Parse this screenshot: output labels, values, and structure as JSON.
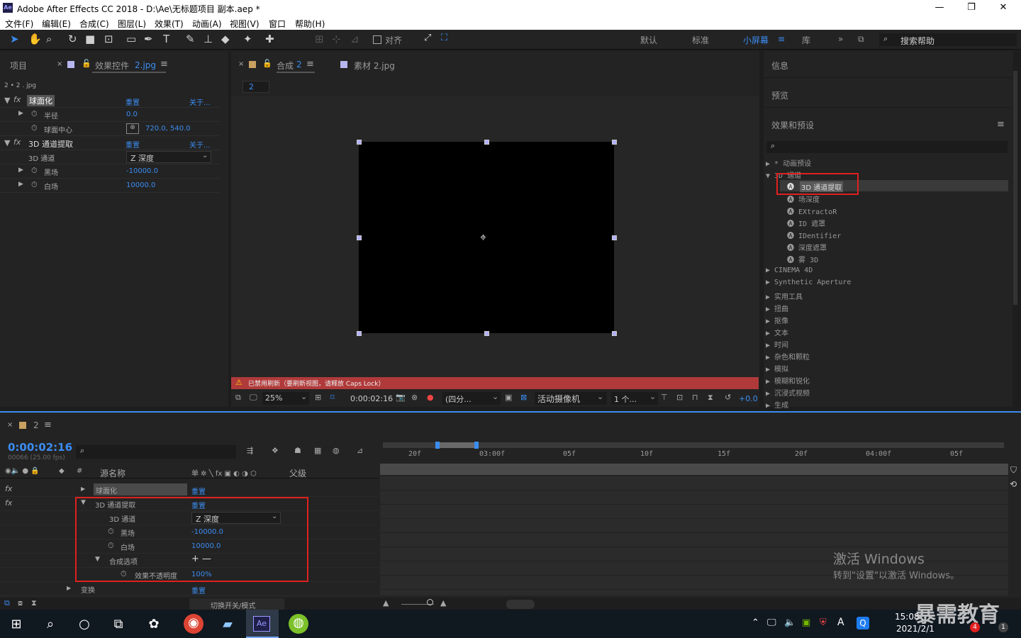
{
  "window": {
    "title": "Adobe After Effects CC 2018 - D:\\Ae\\无标题项目 副本.aep *",
    "logo": "Ae"
  },
  "menu": [
    "文件(F)",
    "编辑(E)",
    "合成(C)",
    "图层(L)",
    "效果(T)",
    "动画(A)",
    "视图(V)",
    "窗口",
    "帮助(H)"
  ],
  "toolbar": {
    "align_label": "对齐",
    "workspaces": [
      "默认",
      "标准",
      "小屏幕",
      "库"
    ],
    "search_placeholder": "搜索帮助"
  },
  "left_panel": {
    "tab_project": "项目",
    "tab_effects": "效果控件",
    "tab_effects_target": "2.jpg",
    "breadcrumb": "2 • 2 . jpg",
    "effects": [
      {
        "name": "球面化",
        "reset": "重置",
        "about": "关于...",
        "props": [
          {
            "name": "半径",
            "value": "0.0"
          },
          {
            "name": "球面中心",
            "value": "720.0, 540.0"
          }
        ]
      },
      {
        "name": "3D 通道提取",
        "reset": "重置",
        "about": "关于...",
        "props": [
          {
            "name": "3D 通道",
            "value": "Z 深度"
          },
          {
            "name": "黑场",
            "value": "-10000.0"
          },
          {
            "name": "白场",
            "value": "10000.0"
          }
        ]
      }
    ]
  },
  "center_panel": {
    "tab_comp": "合成",
    "tab_comp_target": "2",
    "tab_footage": "素材 2.jpg",
    "sub_tab": "2",
    "warning": "已禁用刷新（要刷新视图，请释放 Caps Lock）",
    "zoom": "25%",
    "timecode": "0:00:02:16",
    "resolution": "(四分...",
    "camera": "活动摄像机",
    "views": "1 个...",
    "exposure": "+0.0"
  },
  "right_panel": {
    "info": "信息",
    "preview": "预览",
    "effects_presets": "效果和预设",
    "items": [
      {
        "label": "▶ * 动画预设"
      },
      {
        "label": "▼ 3D 通道"
      },
      {
        "label": "3D 通道提取"
      },
      {
        "label": "场深度"
      },
      {
        "label": "EXtractoR"
      },
      {
        "label": "ID 遮罩"
      },
      {
        "label": "IDentifier"
      },
      {
        "label": "深度遮罩"
      },
      {
        "label": "雾 3D"
      },
      {
        "label": "▶ CINEMA 4D"
      },
      {
        "label": "▶ Synthetic Aperture"
      },
      {
        "label": "▶ 实用工具"
      },
      {
        "label": "▶ 扭曲"
      },
      {
        "label": "▶ 抠像"
      },
      {
        "label": "▶ 文本"
      },
      {
        "label": "▶ 时间"
      },
      {
        "label": "▶ 杂色和颗粒"
      },
      {
        "label": "▶ 模拟"
      },
      {
        "label": "▶ 模糊和锐化"
      },
      {
        "label": "▶ 沉浸式视频"
      },
      {
        "label": "▶ 生成"
      }
    ]
  },
  "timeline": {
    "tab": "2",
    "timecode": "0:00:02:16",
    "frames": "00066 (25.00 fps)",
    "col_source": "源名称",
    "col_parent": "父级",
    "col_switches": "单 ✲ ╲ fx ▣ ◐ ◑ ⬡",
    "ruler": [
      "20f",
      "03:00f",
      "05f",
      "10f",
      "15f",
      "20f",
      "04:00f",
      "05f"
    ],
    "rows": [
      {
        "label": "球面化",
        "value": "重置"
      },
      {
        "label": "3D 通道提取",
        "value": "重置"
      },
      {
        "label": "3D 通道",
        "value": "Z 深度"
      },
      {
        "label": "黑场",
        "value": "-10000.0"
      },
      {
        "label": "白场",
        "value": "10000.0"
      },
      {
        "label": "合成选项",
        "value": "+ —"
      },
      {
        "label": "效果不透明度",
        "value": "100%"
      },
      {
        "label": "变换",
        "value": "重置"
      }
    ],
    "footer_toggle": "切换开关/模式"
  },
  "watermark": {
    "line1": "激活 Windows",
    "line2": "转到\"设置\"以激活 Windows。"
  },
  "taskbar": {
    "time": "15:08",
    "date": "2021/2/1",
    "ime": "A",
    "brand": "暴需教育",
    "notif_badge": "4",
    "notif2": "1",
    "ae_label": "Ae"
  }
}
